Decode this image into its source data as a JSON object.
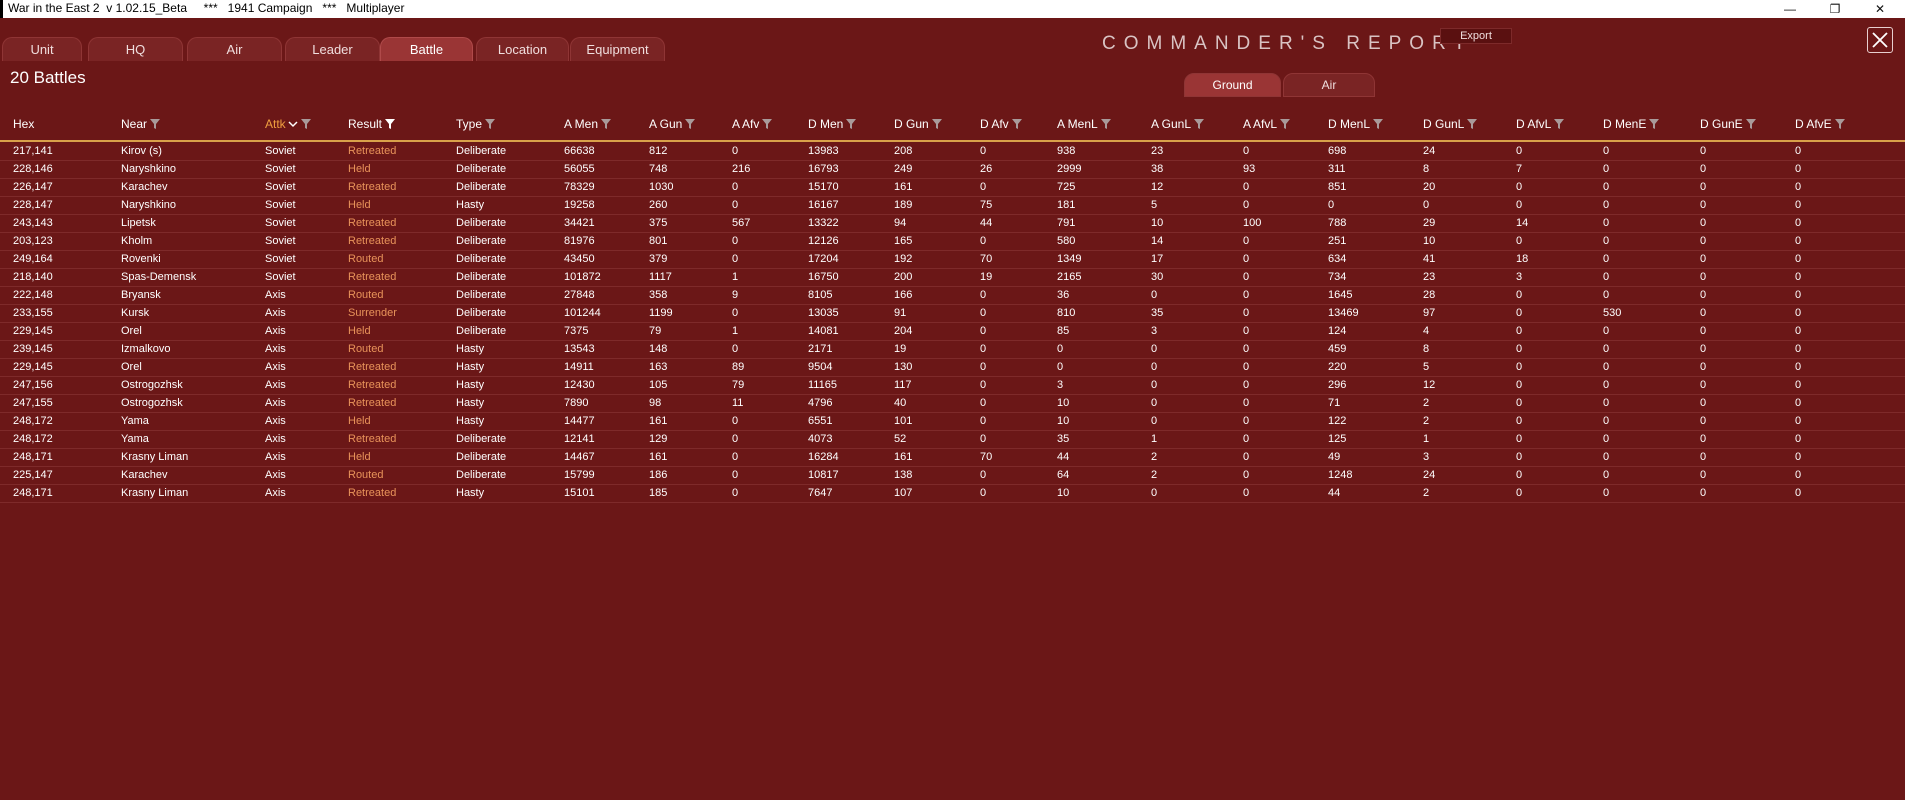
{
  "window": {
    "title": "War in the East 2  v 1.02.15_Beta     ***   1941 Campaign   ***   Multiplayer",
    "minimize": "—",
    "restore": "❐",
    "close": "✕"
  },
  "tabs": [
    {
      "label": "Unit"
    },
    {
      "label": "HQ"
    },
    {
      "label": "Air"
    },
    {
      "label": "Leader"
    },
    {
      "label": "Battle",
      "active": true
    },
    {
      "label": "Location"
    },
    {
      "label": "Equipment"
    }
  ],
  "report_title": "COMMANDER'S   REPORT",
  "export_label": "Export",
  "close_icon": "✕",
  "battles_count": "20 Battles",
  "subtabs": [
    {
      "label": "Ground",
      "active": true
    },
    {
      "label": "Air"
    }
  ],
  "columns": [
    "Hex",
    "Near",
    "Attk",
    "Result",
    "Type",
    "A Men",
    "A Gun",
    "A Afv",
    "D Men",
    "D Gun",
    "D Afv",
    "A MenL",
    "A GunL",
    "A AfvL",
    "D MenL",
    "D GunL",
    "D AfvL",
    "D MenE",
    "D GunE",
    "D AfvE"
  ],
  "rows": [
    [
      "217,141",
      "Kirov (s)",
      "Soviet",
      "Retreated",
      "Deliberate",
      "66638",
      "812",
      "0",
      "13983",
      "208",
      "0",
      "938",
      "23",
      "0",
      "698",
      "24",
      "0",
      "0",
      "0",
      "0"
    ],
    [
      "228,146",
      "Naryshkino",
      "Soviet",
      "Held",
      "Deliberate",
      "56055",
      "748",
      "216",
      "16793",
      "249",
      "26",
      "2999",
      "38",
      "93",
      "311",
      "8",
      "7",
      "0",
      "0",
      "0"
    ],
    [
      "226,147",
      "Karachev",
      "Soviet",
      "Retreated",
      "Deliberate",
      "78329",
      "1030",
      "0",
      "15170",
      "161",
      "0",
      "725",
      "12",
      "0",
      "851",
      "20",
      "0",
      "0",
      "0",
      "0"
    ],
    [
      "228,147",
      "Naryshkino",
      "Soviet",
      "Held",
      "Hasty",
      "19258",
      "260",
      "0",
      "16167",
      "189",
      "75",
      "181",
      "5",
      "0",
      "0",
      "0",
      "0",
      "0",
      "0",
      "0"
    ],
    [
      "243,143",
      "Lipetsk",
      "Soviet",
      "Retreated",
      "Deliberate",
      "34421",
      "375",
      "567",
      "13322",
      "94",
      "44",
      "791",
      "10",
      "100",
      "788",
      "29",
      "14",
      "0",
      "0",
      "0"
    ],
    [
      "203,123",
      "Kholm",
      "Soviet",
      "Retreated",
      "Deliberate",
      "81976",
      "801",
      "0",
      "12126",
      "165",
      "0",
      "580",
      "14",
      "0",
      "251",
      "10",
      "0",
      "0",
      "0",
      "0"
    ],
    [
      "249,164",
      "Rovenki",
      "Soviet",
      "Routed",
      "Deliberate",
      "43450",
      "379",
      "0",
      "17204",
      "192",
      "70",
      "1349",
      "17",
      "0",
      "634",
      "41",
      "18",
      "0",
      "0",
      "0"
    ],
    [
      "218,140",
      "Spas-Demensk",
      "Soviet",
      "Retreated",
      "Deliberate",
      "101872",
      "1117",
      "1",
      "16750",
      "200",
      "19",
      "2165",
      "30",
      "0",
      "734",
      "23",
      "3",
      "0",
      "0",
      "0"
    ],
    [
      "222,148",
      "Bryansk",
      "Axis",
      "Routed",
      "Deliberate",
      "27848",
      "358",
      "9",
      "8105",
      "166",
      "0",
      "36",
      "0",
      "0",
      "1645",
      "28",
      "0",
      "0",
      "0",
      "0"
    ],
    [
      "233,155",
      "Kursk",
      "Axis",
      "Surrender",
      "Deliberate",
      "101244",
      "1199",
      "0",
      "13035",
      "91",
      "0",
      "810",
      "35",
      "0",
      "13469",
      "97",
      "0",
      "530",
      "0",
      "0"
    ],
    [
      "229,145",
      "Orel",
      "Axis",
      "Held",
      "Deliberate",
      "7375",
      "79",
      "1",
      "14081",
      "204",
      "0",
      "85",
      "3",
      "0",
      "124",
      "4",
      "0",
      "0",
      "0",
      "0"
    ],
    [
      "239,145",
      "Izmalkovo",
      "Axis",
      "Routed",
      "Hasty",
      "13543",
      "148",
      "0",
      "2171",
      "19",
      "0",
      "0",
      "0",
      "0",
      "459",
      "8",
      "0",
      "0",
      "0",
      "0"
    ],
    [
      "229,145",
      "Orel",
      "Axis",
      "Retreated",
      "Hasty",
      "14911",
      "163",
      "89",
      "9504",
      "130",
      "0",
      "0",
      "0",
      "0",
      "220",
      "5",
      "0",
      "0",
      "0",
      "0"
    ],
    [
      "247,156",
      "Ostrogozhsk",
      "Axis",
      "Retreated",
      "Hasty",
      "12430",
      "105",
      "79",
      "11165",
      "117",
      "0",
      "3",
      "0",
      "0",
      "296",
      "12",
      "0",
      "0",
      "0",
      "0"
    ],
    [
      "247,155",
      "Ostrogozhsk",
      "Axis",
      "Retreated",
      "Hasty",
      "7890",
      "98",
      "11",
      "4796",
      "40",
      "0",
      "10",
      "0",
      "0",
      "71",
      "2",
      "0",
      "0",
      "0",
      "0"
    ],
    [
      "248,172",
      "Yama",
      "Axis",
      "Held",
      "Hasty",
      "14477",
      "161",
      "0",
      "6551",
      "101",
      "0",
      "10",
      "0",
      "0",
      "122",
      "2",
      "0",
      "0",
      "0",
      "0"
    ],
    [
      "248,172",
      "Yama",
      "Axis",
      "Retreated",
      "Deliberate",
      "12141",
      "129",
      "0",
      "4073",
      "52",
      "0",
      "35",
      "1",
      "0",
      "125",
      "1",
      "0",
      "0",
      "0",
      "0"
    ],
    [
      "248,171",
      "Krasny Liman",
      "Axis",
      "Held",
      "Deliberate",
      "14467",
      "161",
      "0",
      "16284",
      "161",
      "70",
      "44",
      "2",
      "0",
      "49",
      "3",
      "0",
      "0",
      "0",
      "0"
    ],
    [
      "225,147",
      "Karachev",
      "Axis",
      "Routed",
      "Deliberate",
      "15799",
      "186",
      "0",
      "10817",
      "138",
      "0",
      "64",
      "2",
      "0",
      "1248",
      "24",
      "0",
      "0",
      "0",
      "0"
    ],
    [
      "248,171",
      "Krasny Liman",
      "Axis",
      "Retreated",
      "Hasty",
      "15101",
      "185",
      "0",
      "7647",
      "107",
      "0",
      "10",
      "0",
      "0",
      "44",
      "2",
      "0",
      "0",
      "0",
      "0"
    ]
  ],
  "colors": {
    "background": "#6b1717",
    "result_text": "#e8935a",
    "sorted_header": "#f0a040",
    "header_line": "#d9a14a"
  }
}
